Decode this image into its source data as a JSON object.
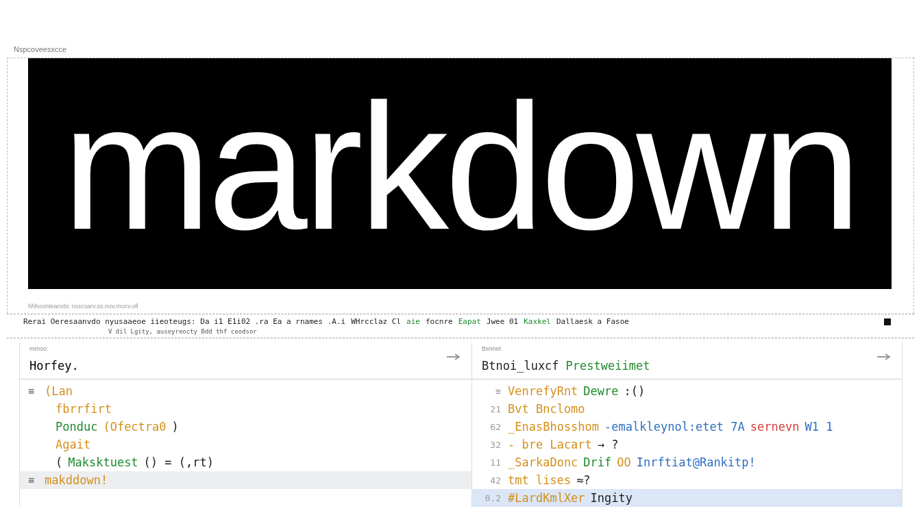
{
  "section_label": "Nspcoveesxcce",
  "banner": {
    "title": "markdown",
    "caption": "hhhoonteanstic roocoarv.ss.nov.mocv.oll"
  },
  "toolbar": {
    "segments": [
      {
        "text": "Rerai Oeresaanvdo nyusaaeoe iieoteugs: Da i1 E1i02 .ra Ea a rnames .A.i",
        "kind": "plain"
      },
      {
        "text": "WHrcclaz Cl",
        "kind": "plain"
      },
      {
        "text": "aie",
        "kind": "string"
      },
      {
        "text": "focnre",
        "kind": "plain"
      },
      {
        "text": "Eapat",
        "kind": "string"
      },
      {
        "text": "Jwee 01",
        "kind": "plain"
      },
      {
        "text": "Kaxkel",
        "kind": "string"
      },
      {
        "text": "Dallaesk a Fasoe",
        "kind": "plain"
      }
    ],
    "subtext": "V dil Lgity, auseyreocty Bdd thf ceodsor"
  },
  "left_pane": {
    "label": "mmoo:",
    "title": "Horfey.",
    "lines": [
      {
        "marker": "≡",
        "selected": false,
        "segments": [
          {
            "text": "(Lan",
            "kind": "keyword"
          }
        ]
      },
      {
        "selected": false,
        "segments": [
          {
            "text": "fbrrfirt",
            "kind": "keyword"
          }
        ]
      },
      {
        "selected": false,
        "segments": [
          {
            "text": "Ponduc",
            "kind": "string"
          },
          {
            "text": "(Ofectra0",
            "kind": "keyword"
          },
          {
            "text": ")",
            "kind": "plain"
          }
        ]
      },
      {
        "selected": false,
        "segments": [
          {
            "text": "Agait",
            "kind": "keyword"
          }
        ]
      },
      {
        "selected": false,
        "segments": [
          {
            "text": " (",
            "kind": "plain"
          },
          {
            "text": "Maksktuest",
            "kind": "string"
          },
          {
            "text": "() = (,rt)",
            "kind": "plain"
          }
        ]
      },
      {
        "marker": "≡",
        "selected": true,
        "segments": [
          {
            "text": "makddown!",
            "kind": "keyword"
          }
        ]
      }
    ]
  },
  "right_pane": {
    "label": "Bsnnet",
    "title": [
      {
        "text": "Btnoi_luxcf",
        "kind": "plain"
      },
      {
        "text": "Prestweiimet",
        "kind": "string"
      }
    ],
    "lines": [
      {
        "number": "≡",
        "selected": false,
        "segments": [
          {
            "text": "VenrefyRnt",
            "kind": "keyword"
          },
          {
            "text": "Dewre",
            "kind": "string"
          },
          {
            "text": ":()",
            "kind": "plain"
          }
        ]
      },
      {
        "number": "21",
        "selected": false,
        "segments": [
          {
            "text": "Bvt Bnclomo",
            "kind": "keyword"
          }
        ]
      },
      {
        "number": "62",
        "selected": false,
        "segments": [
          {
            "text": "_EnasBhosshom",
            "kind": "keyword"
          },
          {
            "text": "-emalkleynol:etet 7A",
            "kind": "func"
          },
          {
            "text": "sernevn",
            "kind": "error"
          },
          {
            "text": "W1 1",
            "kind": "func"
          }
        ]
      },
      {
        "number": "32",
        "selected": false,
        "segments": [
          {
            "text": "- bre Lacart",
            "kind": "keyword"
          },
          {
            "text": "→ ?",
            "kind": "plain"
          }
        ]
      },
      {
        "number": "11",
        "selected": false,
        "segments": [
          {
            "text": "_SarkaDonc",
            "kind": "keyword"
          },
          {
            "text": "Drif",
            "kind": "string"
          },
          {
            "text": "OO",
            "kind": "keyword"
          },
          {
            "text": "Inrftiat@Rankitp!",
            "kind": "func"
          }
        ]
      },
      {
        "number": "42",
        "selected": false,
        "segments": [
          {
            "text": "tmt lises",
            "kind": "keyword"
          },
          {
            "text": "≈?",
            "kind": "plain"
          }
        ]
      },
      {
        "number": "0.2",
        "selected": true,
        "segments": [
          {
            "text": "#LardKmlXer",
            "kind": "keyword"
          },
          {
            "text": "Ingity",
            "kind": "plain"
          }
        ]
      }
    ]
  }
}
